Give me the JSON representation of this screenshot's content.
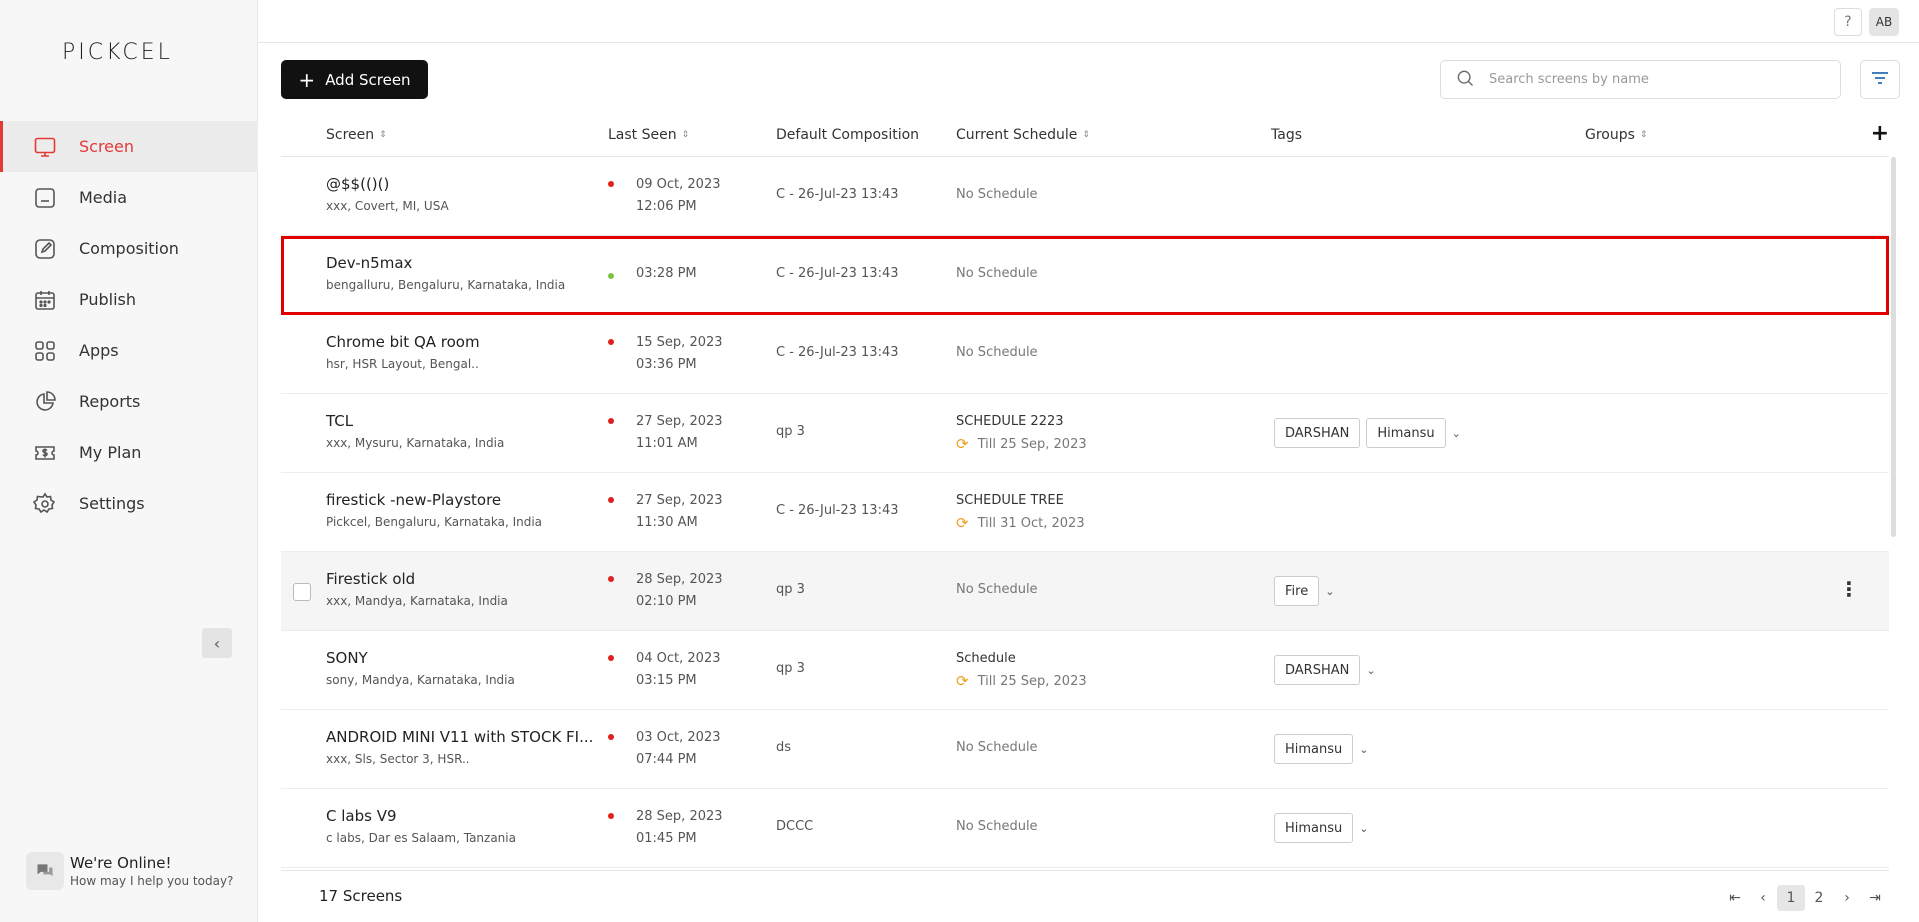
{
  "app": {
    "logo": "PICKCEL"
  },
  "sidebar": {
    "items": [
      {
        "label": "Screen",
        "icon": "monitor-icon",
        "active": true
      },
      {
        "label": "Media",
        "icon": "media-icon"
      },
      {
        "label": "Composition",
        "icon": "edit-icon"
      },
      {
        "label": "Publish",
        "icon": "calendar-icon"
      },
      {
        "label": "Apps",
        "icon": "grid-icon"
      },
      {
        "label": "Reports",
        "icon": "pie-chart-icon"
      },
      {
        "label": "My Plan",
        "icon": "dollar-ticket-icon"
      },
      {
        "label": "Settings",
        "icon": "gear-icon"
      }
    ],
    "collapse_glyph": "‹",
    "chat": {
      "title": "We're Online!",
      "subtitle": "How may I help you today?"
    }
  },
  "topbar": {
    "help": "?",
    "avatar": "AB"
  },
  "toolbar": {
    "add_label": "Add Screen",
    "search_placeholder": "Search screens by name"
  },
  "table": {
    "columns": [
      "Screen",
      "Last Seen",
      "Default Composition",
      "Current Schedule",
      "Tags",
      "Groups"
    ],
    "rows": [
      {
        "name": "@$$(()()",
        "location": "xxx, Covert, MI, USA",
        "status": "offline",
        "seen_date": "09 Oct, 2023",
        "seen_time": "12:06 PM",
        "composition": "C - 26-Jul-23 13:43",
        "schedule": "No Schedule",
        "schedule_till": "",
        "tags": []
      },
      {
        "name": "Dev-n5max",
        "location": "bengalluru, Bengaluru, Karnataka, India",
        "status": "online",
        "seen_date": "",
        "seen_time": "03:28 PM",
        "composition": "C - 26-Jul-23 13:43",
        "schedule": "No Schedule",
        "schedule_till": "",
        "tags": []
      },
      {
        "name": "Chrome bit QA room",
        "location": "hsr, HSR Layout, Bengal..",
        "status": "offline",
        "seen_date": "15 Sep, 2023",
        "seen_time": "03:36 PM",
        "composition": "C - 26-Jul-23 13:43",
        "schedule": "No Schedule",
        "schedule_till": "",
        "tags": []
      },
      {
        "name": "TCL",
        "location": "xxx, Mysuru, Karnataka, India",
        "status": "offline",
        "seen_date": "27 Sep, 2023",
        "seen_time": "11:01 AM",
        "composition": "qp 3",
        "schedule": "SCHEDULE 2223",
        "schedule_till": "Till 25 Sep, 2023",
        "tags": [
          "DARSHAN",
          "Himansu"
        ]
      },
      {
        "name": "firestick -new-Playstore",
        "location": "Pickcel, Bengaluru, Karnataka, India",
        "status": "offline",
        "seen_date": "27 Sep, 2023",
        "seen_time": "11:30 AM",
        "composition": "C - 26-Jul-23 13:43",
        "schedule": "SCHEDULE TREE",
        "schedule_till": "Till 31 Oct, 2023",
        "tags": []
      },
      {
        "name": "Firestick old",
        "location": "xxx, Mandya, Karnataka, India",
        "status": "offline",
        "seen_date": "28 Sep, 2023",
        "seen_time": "02:10 PM",
        "composition": "qp 3",
        "schedule": "No Schedule",
        "schedule_till": "",
        "tags": [
          "Fire"
        ]
      },
      {
        "name": "SONY",
        "location": "sony, Mandya, Karnataka, India",
        "status": "offline",
        "seen_date": "04 Oct, 2023",
        "seen_time": "03:15 PM",
        "composition": "qp 3",
        "schedule": "Schedule",
        "schedule_till": "Till 25 Sep, 2023",
        "tags": [
          "DARSHAN"
        ]
      },
      {
        "name": "ANDROID MINI V11 with STOCK FI...",
        "location": "xxx, Sls, Sector 3, HSR..",
        "status": "offline",
        "seen_date": "03 Oct, 2023",
        "seen_time": "07:44 PM",
        "composition": "ds",
        "schedule": "No Schedule",
        "schedule_till": "",
        "tags": [
          "Himansu"
        ]
      },
      {
        "name": "C labs V9",
        "location": "c labs, Dar es Salaam, Tanzania",
        "status": "offline",
        "seen_date": "28 Sep, 2023",
        "seen_time": "01:45 PM",
        "composition": "DCCC",
        "schedule": "No Schedule",
        "schedule_till": "",
        "tags": [
          "Himansu"
        ]
      }
    ]
  },
  "colors": {
    "accent": "#e53935",
    "online": "#7cc242",
    "offline": "#e02020",
    "sync": "#f0a020",
    "selection": "#e10000"
  },
  "footer": {
    "count": "17 Screens",
    "pages": [
      "1",
      "2"
    ],
    "current_page": "1"
  }
}
